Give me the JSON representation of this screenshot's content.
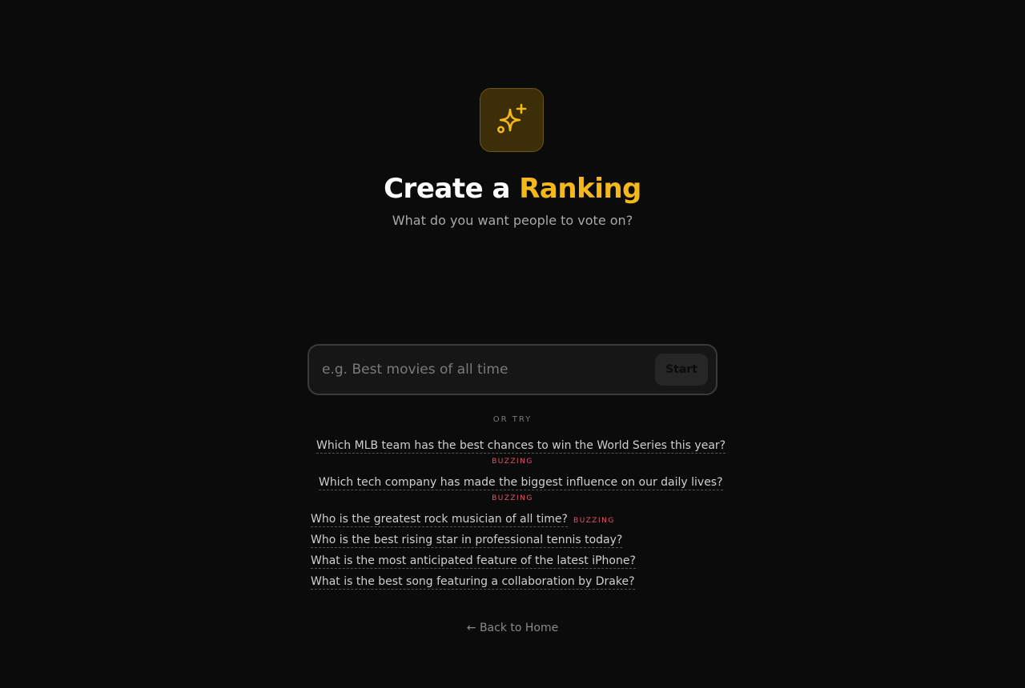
{
  "header": {
    "icon": "sparkles-icon",
    "title_prefix": "Create a ",
    "title_accent": "Ranking",
    "subtitle": "What do you want people to vote on?",
    "accent_color": "#f5b81a"
  },
  "search": {
    "value": "",
    "placeholder": "e.g. Best movies of all time",
    "start_label": "Start"
  },
  "suggestions": {
    "divider_label": "OR TRY",
    "items": [
      {
        "text": "Which MLB team has the best chances to win the World Series this year?",
        "badge": "BUZZING"
      },
      {
        "text": "Which tech company has made the biggest influence on our daily lives?",
        "badge": "BUZZING"
      },
      {
        "text": "Who is the greatest rock musician of all time?",
        "badge": "BUZZING"
      },
      {
        "text": "Who is the best rising star in professional tennis today?",
        "badge": ""
      },
      {
        "text": "What is the most anticipated feature of the latest iPhone?",
        "badge": ""
      },
      {
        "text": "What is the best song featuring a collaboration by Drake?",
        "badge": ""
      }
    ]
  },
  "footer": {
    "back_arrow": "←",
    "back_label": "Back to Home"
  }
}
